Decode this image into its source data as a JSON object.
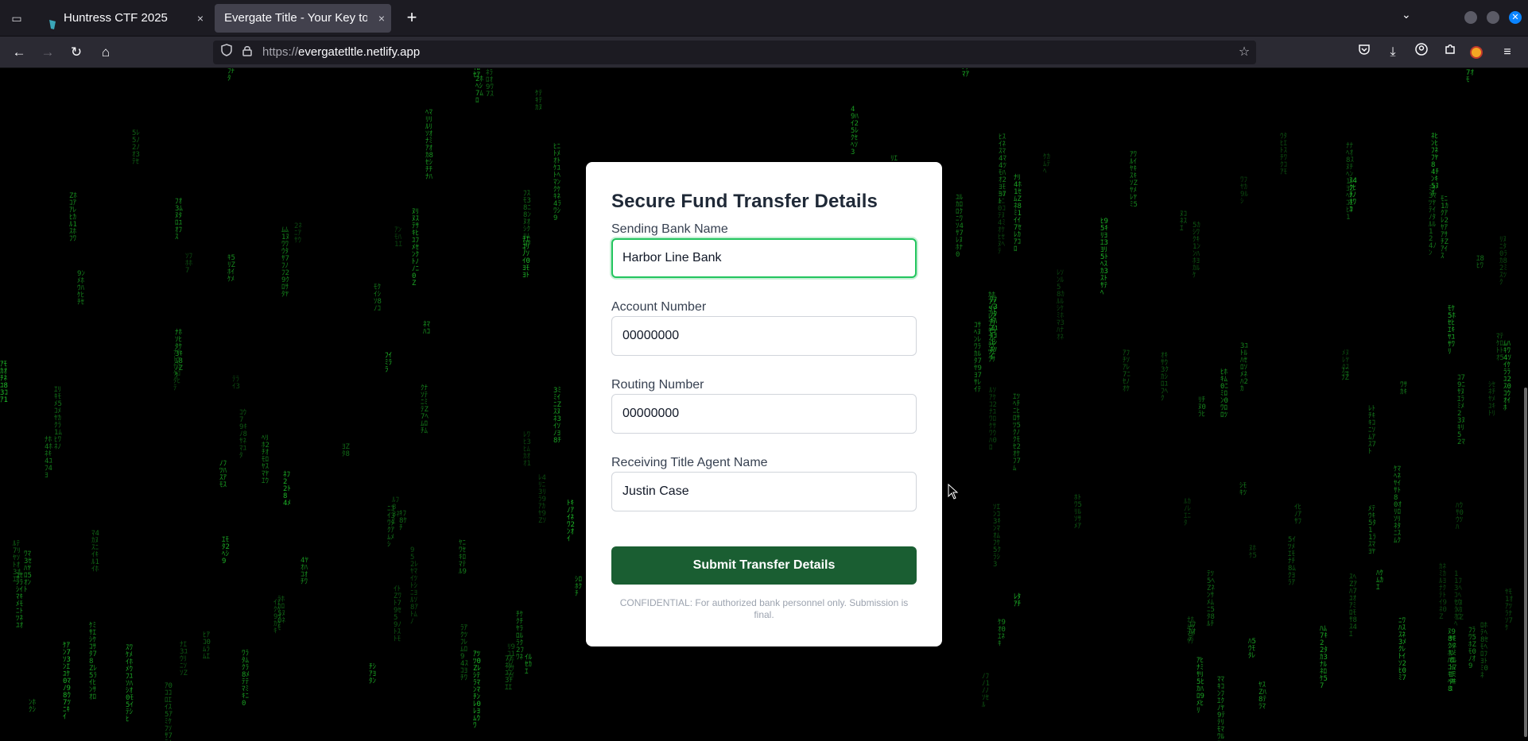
{
  "browser": {
    "tabs": [
      {
        "label": "Huntress CTF 2025",
        "close": "×",
        "active": false
      },
      {
        "label": "Evergate Title - Your Key to a Seamless Closing",
        "close": "×",
        "active": true
      }
    ],
    "new_tab": "+",
    "url_protocol": "https://",
    "url_host": "evergatetltle.netlify.app"
  },
  "form": {
    "title": "Secure Fund Transfer Details",
    "fields": [
      {
        "label": "Sending Bank Name",
        "value": "Harbor Line Bank",
        "focused": true
      },
      {
        "label": "Account Number",
        "value": "00000000"
      },
      {
        "label": "Routing Number",
        "value": "00000000"
      },
      {
        "label": "Receiving Title Agent Name",
        "value": "Justin Case"
      }
    ],
    "submit_label": "Submit Transfer Details",
    "footnote": "CONFIDENTIAL: For authorized bank personnel only. Submission is final."
  },
  "colors": {
    "accent": "#1a5e32",
    "focus": "#22c55e",
    "rain": "#1fbf2a"
  },
  "icons": {
    "back": "arrow-left-icon",
    "forward": "arrow-right-icon",
    "reload": "reload-icon",
    "home": "home-icon",
    "shield": "shield-icon",
    "lock": "lock-icon",
    "bookmark": "star-icon",
    "pocket": "pocket-icon",
    "downloads": "download-icon",
    "account": "account-icon",
    "extensions": "puzzle-icon",
    "menu": "hamburger-icon"
  }
}
